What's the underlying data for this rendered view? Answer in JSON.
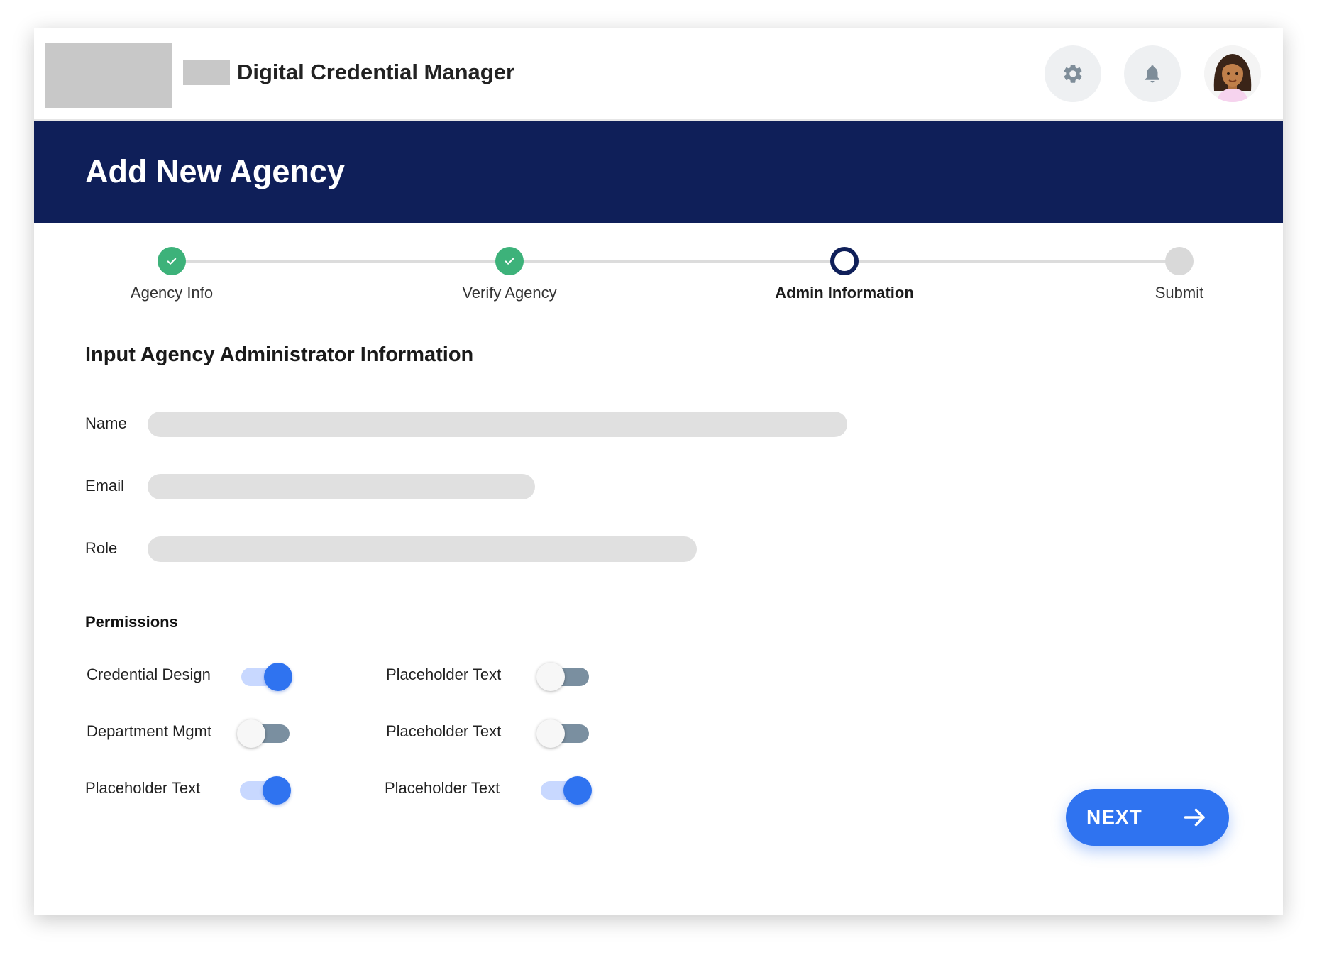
{
  "header": {
    "app_title": "Digital Credential Manager",
    "settings_icon": "gear-icon",
    "notifications_icon": "bell-icon"
  },
  "banner": {
    "title": "Add New Agency"
  },
  "stepper": {
    "steps": [
      {
        "label": "Agency Info",
        "status": "complete"
      },
      {
        "label": "Verify Agency",
        "status": "complete"
      },
      {
        "label": "Admin Information",
        "status": "current"
      },
      {
        "label": "Submit",
        "status": "upcoming"
      }
    ]
  },
  "form": {
    "title": "Input Agency Administrator Information",
    "fields": [
      {
        "label": "Name",
        "value": ""
      },
      {
        "label": "Email",
        "value": ""
      },
      {
        "label": "Role",
        "value": ""
      }
    ]
  },
  "permissions": {
    "title": "Permissions",
    "items": [
      {
        "label": "Credential Design",
        "enabled": true
      },
      {
        "label": "Department Mgmt",
        "enabled": false
      },
      {
        "label": "Placeholder Text",
        "enabled": true
      },
      {
        "label": "Placeholder Text",
        "enabled": false
      },
      {
        "label": "Placeholder Text",
        "enabled": false
      },
      {
        "label": "Placeholder Text",
        "enabled": true
      }
    ]
  },
  "actions": {
    "next_label": "NEXT"
  },
  "colors": {
    "banner": "#0f1f59",
    "accent": "#2f73f0",
    "success": "#3db27a",
    "input_bg": "#e0e0e0"
  }
}
